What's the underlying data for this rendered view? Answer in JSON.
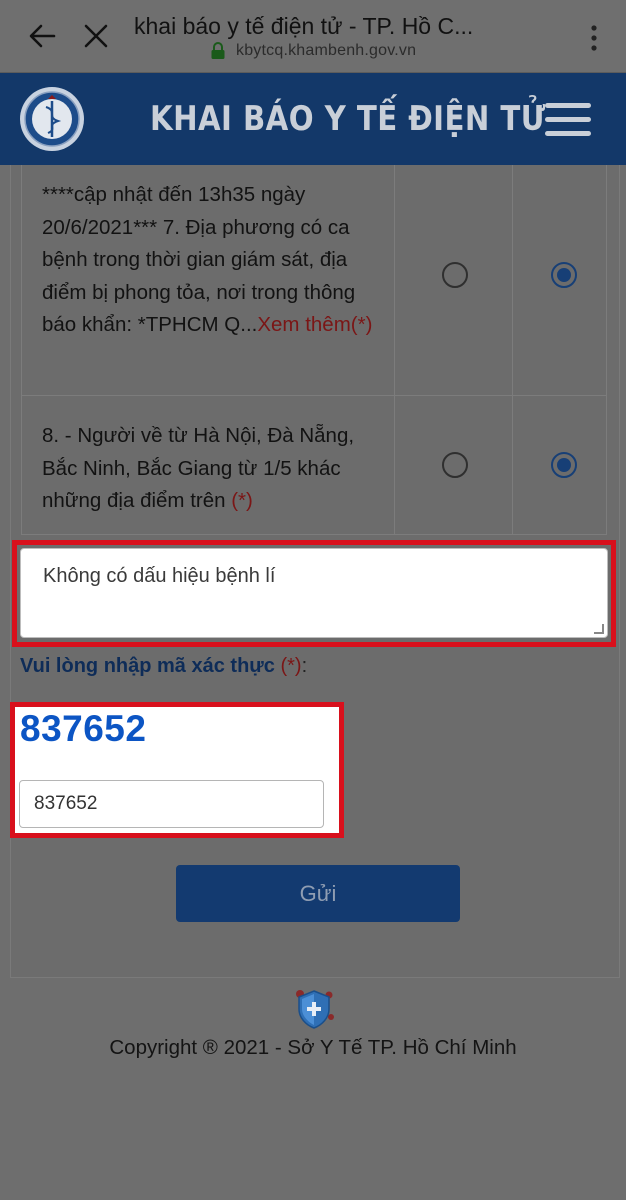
{
  "browser": {
    "tab_title": "khai báo y tế điện tử - TP. Hồ C...",
    "url": "kbytcq.khambenh.gov.vn"
  },
  "header": {
    "title": "KHAI BÁO Y TẾ ĐIỆN TỬ"
  },
  "questions": [
    {
      "text": "****cập nhật đến 13h35 ngày 20/6/2021*** 7. Địa phương có ca bệnh trong thời gian giám sát, địa điểm bị phong tỏa, nơi trong thông báo khẩn: *TPHCM Q...",
      "more_link": "Xem thêm",
      "required_mark": "(*)",
      "selected": "second"
    },
    {
      "text": "8. - Người về từ Hà Nội, Đà Nẵng, Bắc Ninh, Bắc Giang từ 1/5 khác những địa điểm trên",
      "required_mark": "(*)",
      "selected": "second"
    }
  ],
  "notes_field": {
    "value": "Không có dấu hiệu bệnh lí"
  },
  "captcha": {
    "label": "Vui lòng nhập mã xác thực",
    "required_mark": "(*)",
    "colon": ":",
    "code": "837652",
    "input_value": "837652"
  },
  "submit_label": "Gửi",
  "footer": {
    "copyright": "Copyright ® 2021 - Sở Y Tế TP. Hồ Chí Minh"
  },
  "colors": {
    "header_bg": "#133869",
    "highlight": "#d8101c",
    "captcha_code": "#0c55c4",
    "required": "#7b1616"
  }
}
